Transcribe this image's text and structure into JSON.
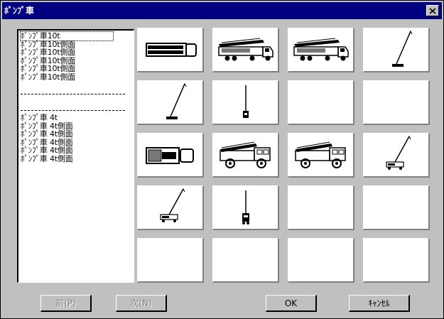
{
  "window": {
    "title": "ﾎﾟﾝﾌﾟ車",
    "close_label": "✕"
  },
  "list": {
    "items": [
      {
        "label": "ﾎﾟﾝﾌﾟ車10t",
        "type": "item",
        "selected": true
      },
      {
        "label": "ﾎﾟﾝﾌﾟ車10t側面",
        "type": "item"
      },
      {
        "label": "ﾎﾟﾝﾌﾟ車10t側面",
        "type": "item"
      },
      {
        "label": "ﾎﾟﾝﾌﾟ車10t側面",
        "type": "item"
      },
      {
        "label": "ﾎﾟﾝﾌﾟ車10t側面",
        "type": "item"
      },
      {
        "label": "ﾎﾟﾝﾌﾟ車10t側面",
        "type": "item"
      },
      {
        "label": "",
        "type": "blank"
      },
      {
        "label": "",
        "type": "separator"
      },
      {
        "label": "",
        "type": "blank"
      },
      {
        "label": "",
        "type": "separator"
      },
      {
        "label": "ﾎﾟﾝﾌﾟ車 4t",
        "type": "item"
      },
      {
        "label": "ﾎﾟﾝﾌﾟ車 4t側面",
        "type": "item"
      },
      {
        "label": "ﾎﾟﾝﾌﾟ車 4t側面",
        "type": "item"
      },
      {
        "label": "ﾎﾟﾝﾌﾟ車 4t側面",
        "type": "item"
      },
      {
        "label": "ﾎﾟﾝﾌﾟ車 4t側面",
        "type": "item"
      },
      {
        "label": "ﾎﾟﾝﾌﾟ車 4t側面",
        "type": "item"
      }
    ]
  },
  "grid": {
    "cells": [
      {
        "icon": "pump-truck-top-icon"
      },
      {
        "icon": "pump-truck-side-icon"
      },
      {
        "icon": "pump-truck-side-icon"
      },
      {
        "icon": "boom-raised-icon"
      },
      {
        "icon": "boom-raised-icon"
      },
      {
        "icon": "boom-vertical-icon"
      },
      {
        "icon": ""
      },
      {
        "icon": ""
      },
      {
        "icon": "pump-truck-4t-top-icon"
      },
      {
        "icon": "pump-truck-4t-side-icon"
      },
      {
        "icon": "pump-truck-4t-side-icon"
      },
      {
        "icon": "truck-boom-raised-icon"
      },
      {
        "icon": "truck-boom-raised-icon"
      },
      {
        "icon": "truck-boom-vertical-icon"
      },
      {
        "icon": ""
      },
      {
        "icon": ""
      },
      {
        "icon": ""
      },
      {
        "icon": ""
      },
      {
        "icon": ""
      },
      {
        "icon": ""
      }
    ]
  },
  "buttons": {
    "prev": "前(P)",
    "next": "次(N)",
    "ok": "OK",
    "cancel": "ｷｬﾝｾﾙ"
  }
}
